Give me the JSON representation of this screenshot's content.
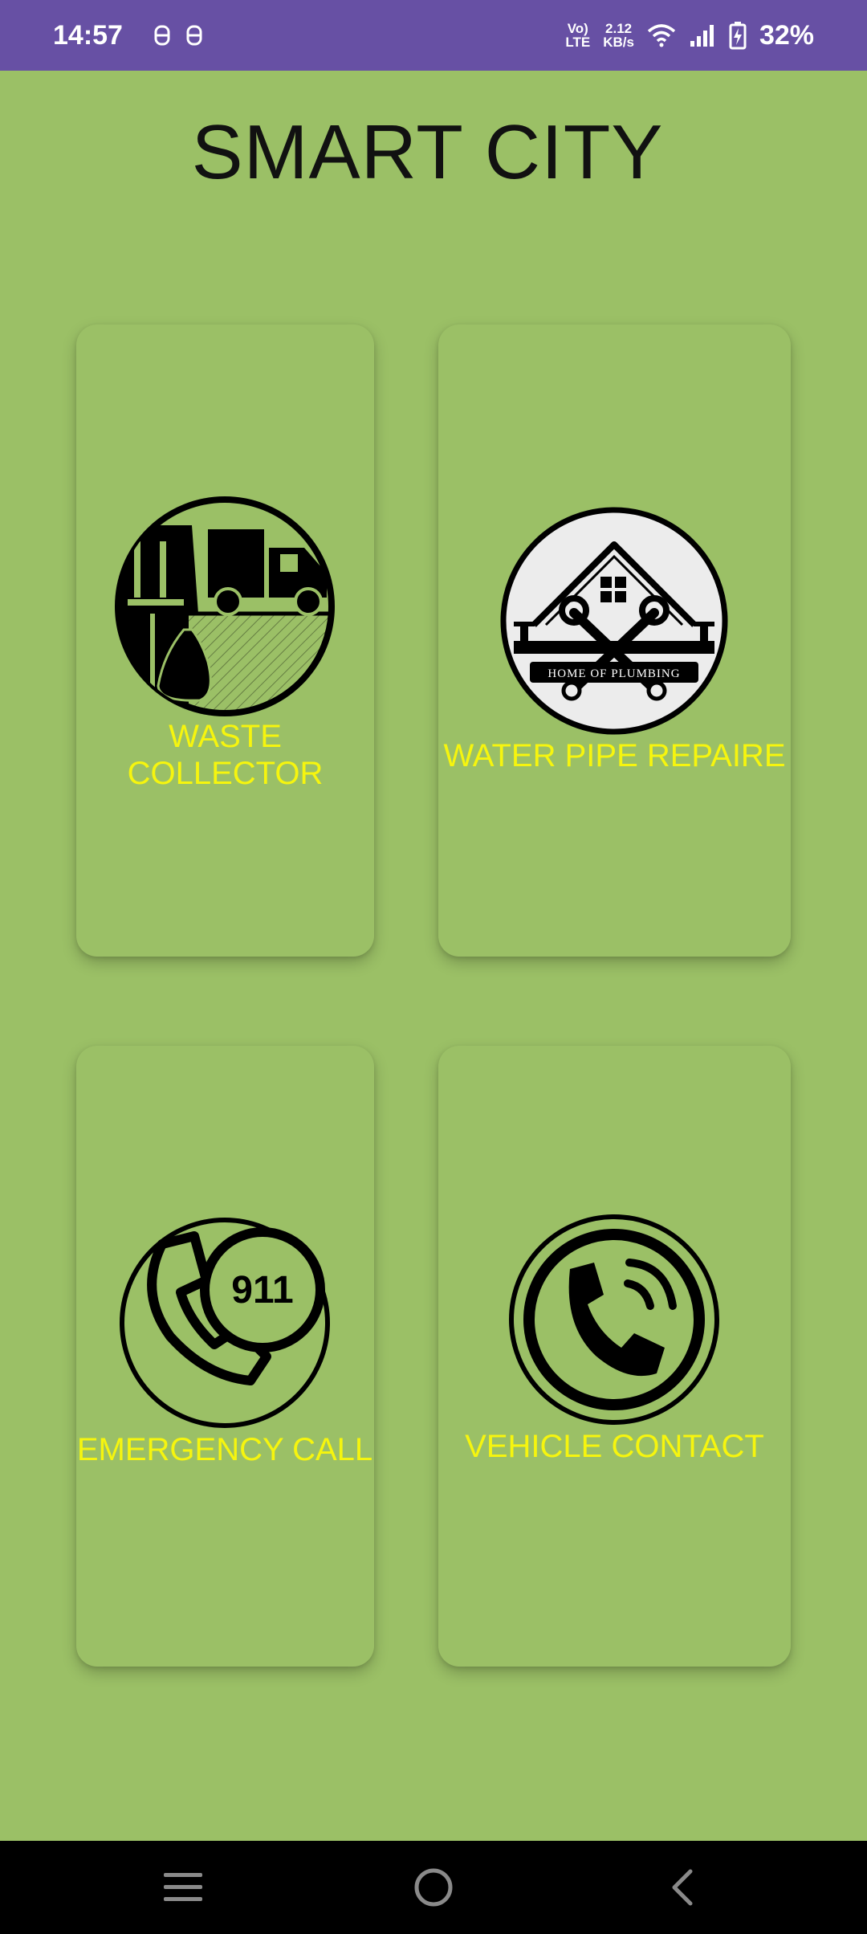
{
  "status_bar": {
    "time": "14:57",
    "network_top": "Vo)",
    "network_bottom": "LTE",
    "speed_top": "2.12",
    "speed_bottom": "KB/s",
    "battery": "32%"
  },
  "page": {
    "title": "SMART CITY"
  },
  "cards": [
    {
      "label": "WASTE\nCOLLECTOR",
      "icon": "garbage-collector-icon"
    },
    {
      "label": "WATER PIPE REPAIRE",
      "icon": "plumbing-icon",
      "badge_text": "HOME OF PLUMBING"
    },
    {
      "label": "EMERGENCY CALL",
      "icon": "emergency-911-icon",
      "badge_text": "911"
    },
    {
      "label": "VEHICLE CONTACT",
      "icon": "phone-call-icon"
    }
  ],
  "colors": {
    "status_bar": "#6750a4",
    "background": "#9bc066",
    "label_yellow": "#f6f50e",
    "nav_bar": "#000000"
  }
}
